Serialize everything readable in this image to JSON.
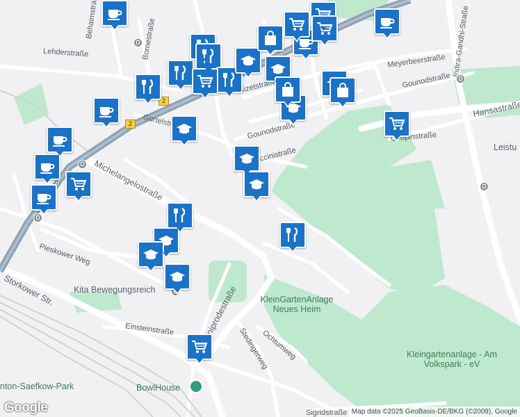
{
  "map": {
    "colors": {
      "background": "#f1f1f4",
      "park": "#bfe9cf",
      "road": "#ffffff",
      "highway": "#8ea1b4",
      "rail": "#c8cbd0",
      "pin": "#1a73c9"
    },
    "streets": [
      "Behaimstraße",
      "Bornestraße",
      "Lehderstraße",
      "Gürtelstraße",
      "Bizetstraße",
      "Gounodstraße",
      "Meyerbeerstraße",
      "Gounodstraße",
      "Hansastraße",
      "Chopinstraße",
      "Puccinistraße",
      "Michelangelostraße",
      "Pieskower Weg",
      "Storkower Str.",
      "Einsteinstraße",
      "Kniprodestraße",
      "Stedingerweg",
      "Ochtumweg",
      "Indira-Gandhi-Straße",
      "Sigridstraße",
      "Leistu"
    ],
    "places": [
      "Kita Bewegungsreich",
      "KleinGartenAnlage Neues Heim",
      "Kleingartenanlage - Am Volkspark - eV",
      "BowlHouse",
      "nton-Saefkow-Park"
    ],
    "route_shields": [
      "2",
      "2"
    ],
    "logo": "Google",
    "attribution": "Map data ©2025 GeoBasis-DE/BKG (©2009), Google",
    "markers": [
      {
        "type": "cafe",
        "icon": "coffee-cup-icon"
      },
      {
        "type": "cafe",
        "icon": "coffee-cup-icon"
      },
      {
        "type": "cafe",
        "icon": "coffee-cup-icon"
      },
      {
        "type": "cafe",
        "icon": "coffee-cup-icon"
      },
      {
        "type": "cafe",
        "icon": "coffee-cup-icon"
      },
      {
        "type": "cafe",
        "icon": "coffee-cup-icon"
      },
      {
        "type": "cafe",
        "icon": "coffee-cup-icon"
      },
      {
        "type": "restaurant",
        "icon": "fork-knife-icon"
      },
      {
        "type": "restaurant",
        "icon": "fork-knife-icon"
      },
      {
        "type": "restaurant",
        "icon": "fork-knife-icon"
      },
      {
        "type": "restaurant",
        "icon": "fork-knife-icon"
      },
      {
        "type": "restaurant",
        "icon": "fork-knife-icon"
      },
      {
        "type": "restaurant",
        "icon": "fork-knife-icon"
      },
      {
        "type": "restaurant",
        "icon": "fork-knife-icon"
      },
      {
        "type": "school",
        "icon": "graduation-cap-icon"
      },
      {
        "type": "school",
        "icon": "graduation-cap-icon"
      },
      {
        "type": "school",
        "icon": "graduation-cap-icon"
      },
      {
        "type": "school",
        "icon": "graduation-cap-icon"
      },
      {
        "type": "school",
        "icon": "graduation-cap-icon"
      },
      {
        "type": "school",
        "icon": "graduation-cap-icon"
      },
      {
        "type": "school",
        "icon": "graduation-cap-icon"
      },
      {
        "type": "school",
        "icon": "graduation-cap-icon"
      },
      {
        "type": "school",
        "icon": "graduation-cap-icon"
      },
      {
        "type": "school",
        "icon": "graduation-cap-icon"
      },
      {
        "type": "grocery",
        "icon": "shopping-cart-icon"
      },
      {
        "type": "grocery",
        "icon": "shopping-cart-icon"
      },
      {
        "type": "grocery",
        "icon": "shopping-cart-icon"
      },
      {
        "type": "grocery",
        "icon": "shopping-cart-icon"
      },
      {
        "type": "grocery",
        "icon": "shopping-cart-icon"
      },
      {
        "type": "grocery",
        "icon": "shopping-cart-icon"
      },
      {
        "type": "grocery",
        "icon": "shopping-cart-icon"
      },
      {
        "type": "shopping",
        "icon": "shopping-bag-icon"
      },
      {
        "type": "shopping",
        "icon": "shopping-bag-icon"
      },
      {
        "type": "shopping",
        "icon": "shopping-bag-icon"
      }
    ]
  }
}
